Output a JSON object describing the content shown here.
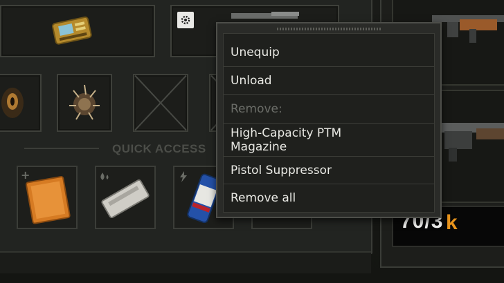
{
  "context_menu": {
    "items": [
      {
        "label": "Unequip",
        "enabled": true
      },
      {
        "label": "Unload",
        "enabled": true
      },
      {
        "label": "Remove:",
        "enabled": false
      },
      {
        "label": "High-Capacity PTM Magazine",
        "enabled": true
      },
      {
        "label": "Pistol Suppressor",
        "enabled": true
      },
      {
        "label": "Remove all",
        "enabled": true
      }
    ]
  },
  "quick_access": {
    "label": "QUICK ACCESS"
  },
  "ammo": {
    "count": "70/3"
  },
  "icons": {
    "settings": "gear-icon",
    "plus": "plus-icon",
    "drops": "drops-icon",
    "lightning": "lightning-icon",
    "currency": "k-icon"
  },
  "colors": {
    "accent": "#e8941c",
    "menu_text": "#e9e9e4",
    "disabled_text": "#6b6d68"
  }
}
